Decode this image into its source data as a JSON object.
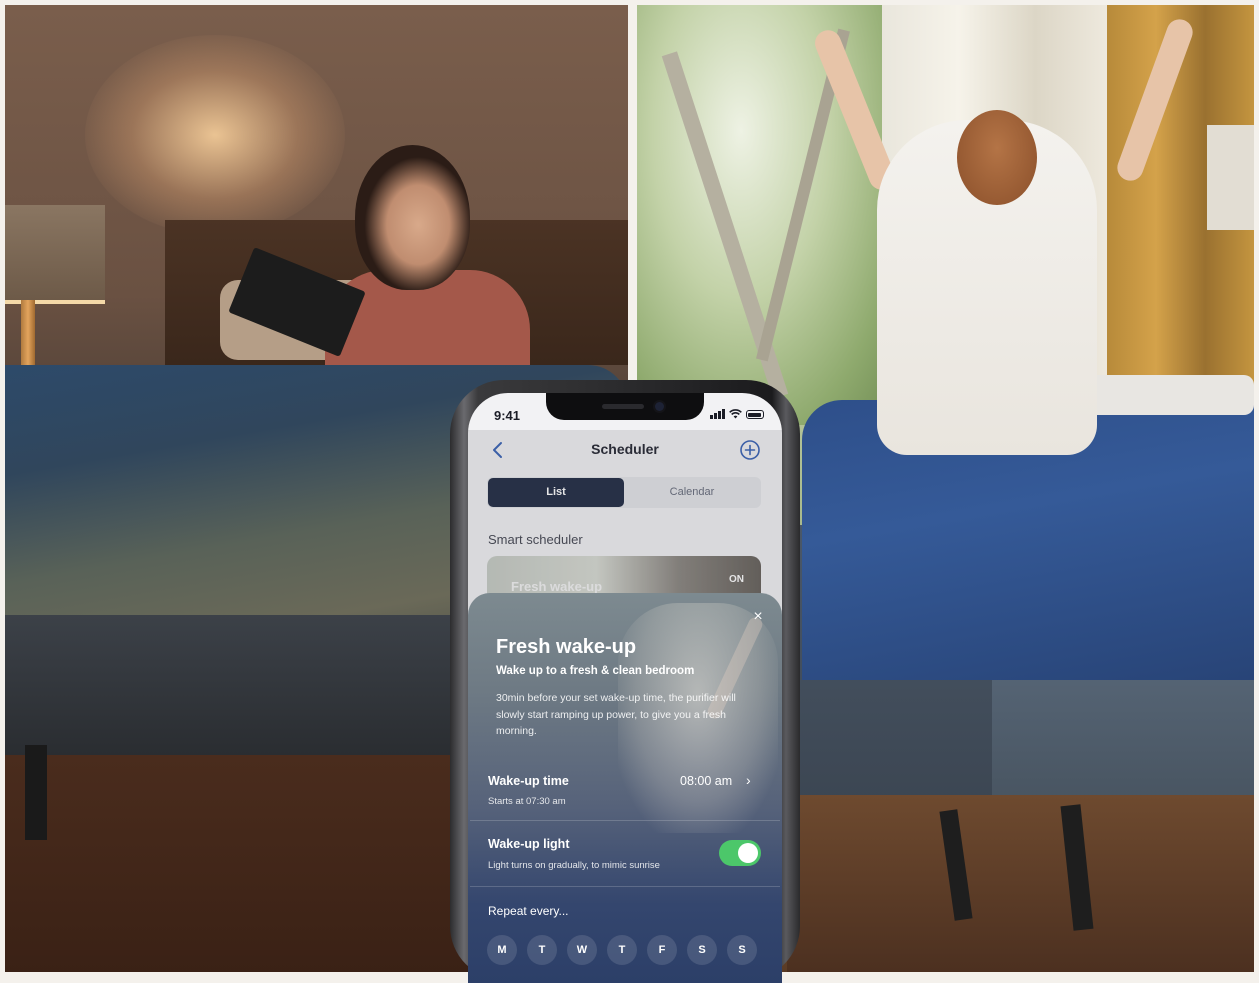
{
  "status_bar": {
    "time": "9:41"
  },
  "header": {
    "title": "Scheduler",
    "back_icon": "chevron-left-icon",
    "add_icon": "plus-circle-icon"
  },
  "tabs": [
    {
      "label": "List",
      "selected": true
    },
    {
      "label": "Calendar",
      "selected": false
    }
  ],
  "section": {
    "label": "Smart scheduler"
  },
  "card": {
    "title": "Fresh wake-up",
    "state": "ON"
  },
  "sheet": {
    "close": "×",
    "title": "Fresh wake-up",
    "subtitle": "Wake up to a fresh & clean bedroom",
    "description": "30min before your set wake-up time, the purifier will slowly start ramping up power, to give you a fresh morning.",
    "wake_time": {
      "label": "Wake-up time",
      "value": "08:00 am",
      "sub": "Starts at 07:30 am"
    },
    "wake_light": {
      "label": "Wake-up light",
      "sub": "Light turns on gradually, to mimic sunrise",
      "enabled": true
    },
    "repeat": {
      "label": "Repeat every...",
      "days": [
        "M",
        "T",
        "W",
        "T",
        "F",
        "S",
        "S"
      ]
    }
  },
  "colors": {
    "accent": "#3e67b8",
    "segment_selected": "#273249",
    "toggle_on": "#4cc76a"
  }
}
